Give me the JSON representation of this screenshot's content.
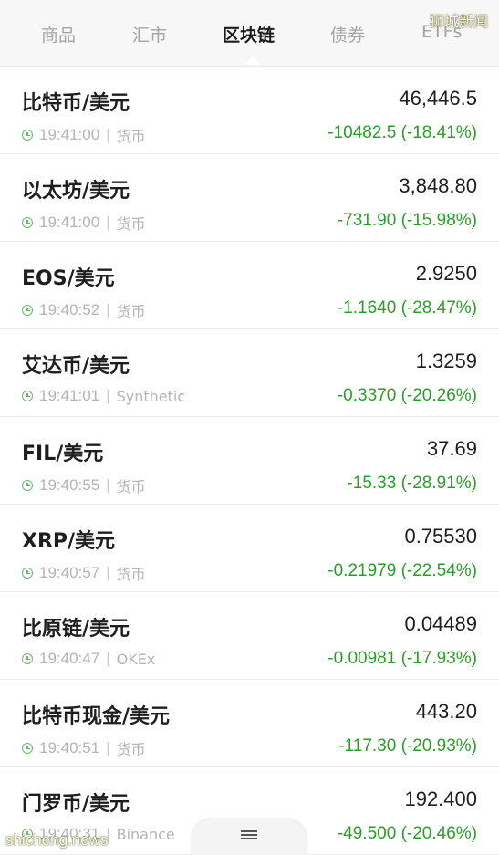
{
  "tabs": [
    {
      "label": "商品"
    },
    {
      "label": "汇市"
    },
    {
      "label": "区块链"
    },
    {
      "label": "债券"
    },
    {
      "label": "ETFs"
    }
  ],
  "active_tab": "区块链",
  "watermark_top": "狮城新闻",
  "watermark_bottom": "shicheng.news",
  "rows": [
    {
      "name": "比特币/美元",
      "price": "46,446.5",
      "time": "19:41:00",
      "source": "货币",
      "change": "-10482.5 (-18.41%)"
    },
    {
      "name": "以太坊/美元",
      "price": "3,848.80",
      "time": "19:41:00",
      "source": "货币",
      "change": "-731.90 (-15.98%)"
    },
    {
      "name": "EOS/美元",
      "price": "2.9250",
      "time": "19:40:52",
      "source": "货币",
      "change": "-1.1640 (-28.47%)"
    },
    {
      "name": "艾达币/美元",
      "price": "1.3259",
      "time": "19:41:01",
      "source": "Synthetic",
      "change": "-0.3370 (-20.26%)"
    },
    {
      "name": "FIL/美元",
      "price": "37.69",
      "time": "19:40:55",
      "source": "货币",
      "change": "-15.33 (-28.91%)"
    },
    {
      "name": "XRP/美元",
      "price": "0.75530",
      "time": "19:40:57",
      "source": "货币",
      "change": "-0.21979 (-22.54%)"
    },
    {
      "name": "比原链/美元",
      "price": "0.04489",
      "time": "19:40:47",
      "source": "OKEx",
      "change": "-0.00981 (-17.93%)"
    },
    {
      "name": "比特币现金/美元",
      "price": "443.20",
      "time": "19:40:51",
      "source": "货币",
      "change": "-117.30 (-20.93%)"
    },
    {
      "name": "门罗币/美元",
      "price": "192.400",
      "time": "19:40:31",
      "source": "Binance",
      "change": "-49.500 (-20.46%)"
    }
  ],
  "icons": {
    "time": "clock-icon",
    "drawer_handle": "menu-lines-icon"
  },
  "colors": {
    "change_negative": "#2a9d2a",
    "tab_active": "#1c1c1c",
    "tab_inactive": "#a3a3a3"
  }
}
